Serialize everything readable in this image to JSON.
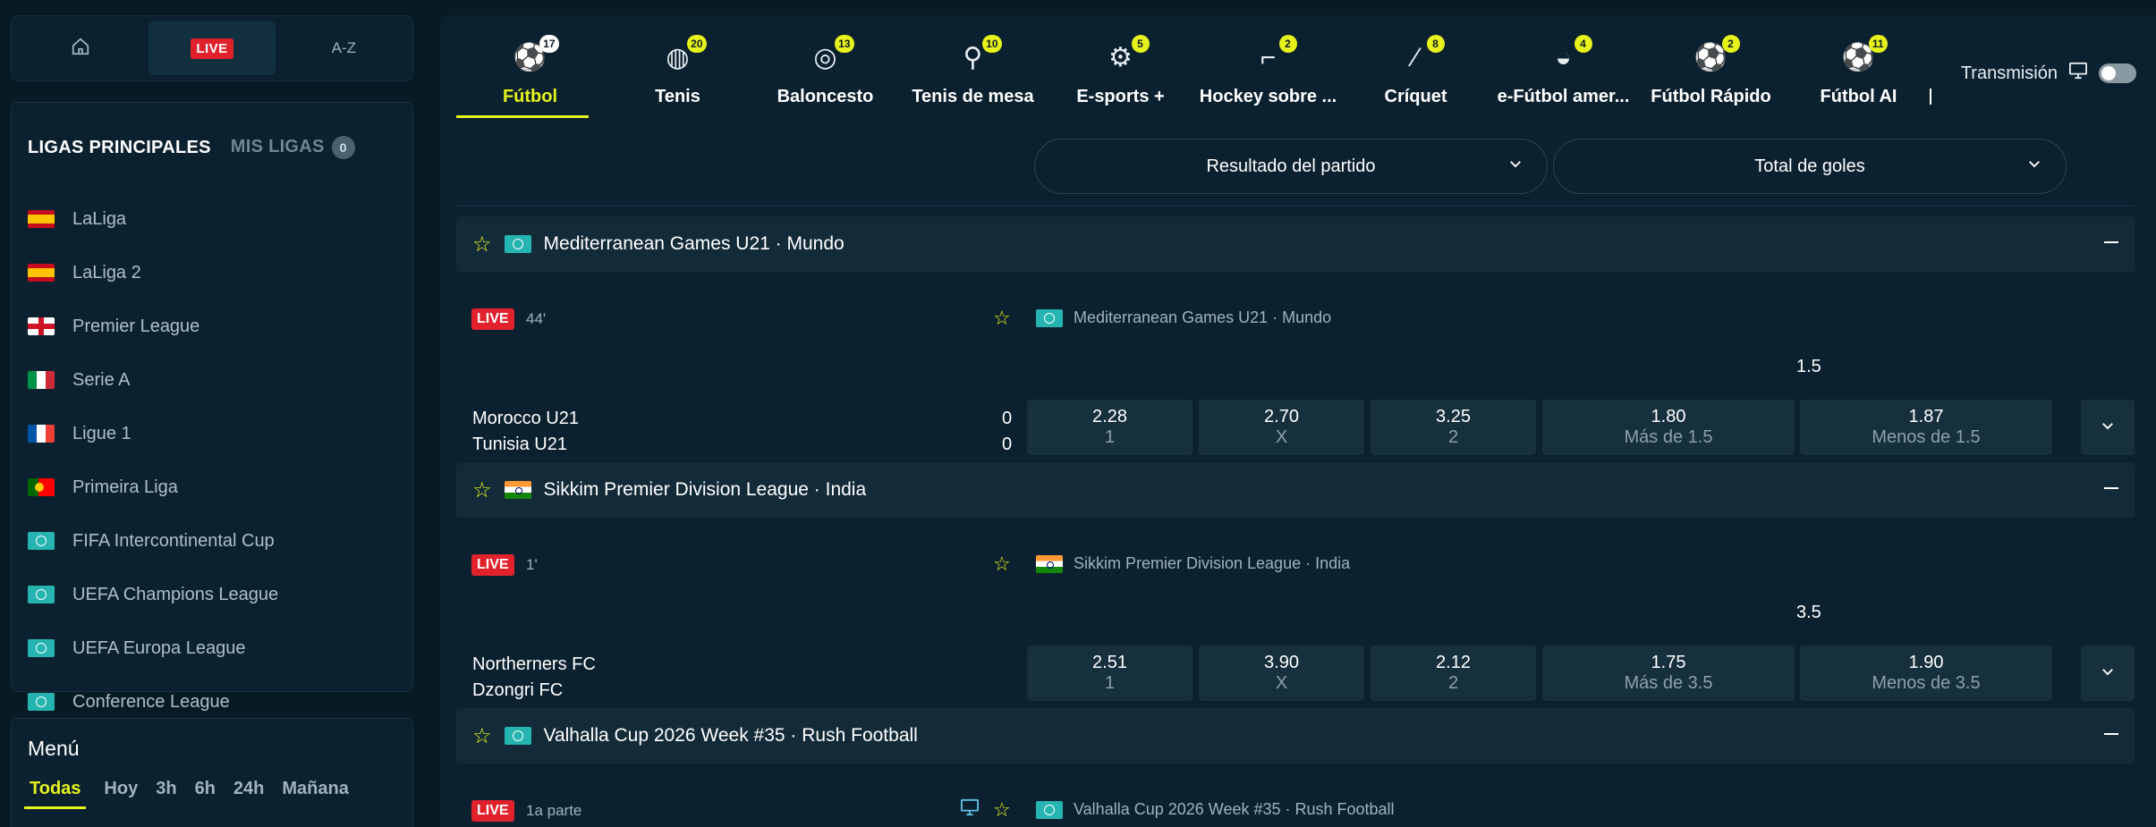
{
  "topnav": {
    "home_icon": "home-icon",
    "live": "LIVE",
    "az": "A-Z"
  },
  "leagues": {
    "tab_principal": "LIGAS PRINCIPALES",
    "tab_mine": "MIS LIGAS",
    "mine_count": "0",
    "items": [
      {
        "label": "LaLiga",
        "flag": "es"
      },
      {
        "label": "LaLiga 2",
        "flag": "es"
      },
      {
        "label": "Premier League",
        "flag": "en"
      },
      {
        "label": "Serie A",
        "flag": "it"
      },
      {
        "label": "Ligue 1",
        "flag": "fr"
      },
      {
        "label": "Primeira Liga",
        "flag": "pt"
      },
      {
        "label": "FIFA Intercontinental Cup",
        "flag": "world"
      },
      {
        "label": "UEFA Champions League",
        "flag": "world"
      },
      {
        "label": "UEFA Europa League",
        "flag": "world"
      },
      {
        "label": "Conference League",
        "flag": "world"
      }
    ]
  },
  "menu": {
    "title": "Menú",
    "tabs": [
      "Todas",
      "Hoy",
      "3h",
      "6h",
      "24h",
      "Mañana"
    ]
  },
  "sports": [
    {
      "label": "Fútbol",
      "count": "17",
      "icon": "soccer-ball-icon",
      "active": true
    },
    {
      "label": "Tenis",
      "count": "20",
      "icon": "tennis-ball-icon"
    },
    {
      "label": "Baloncesto",
      "count": "13",
      "icon": "basketball-icon"
    },
    {
      "label": "Tenis de mesa",
      "count": "10",
      "icon": "ping-pong-icon"
    },
    {
      "label": "E-sports +",
      "count": "5",
      "icon": "gamepad-icon"
    },
    {
      "label": "Hockey sobre ...",
      "count": "2",
      "icon": "hockey-icon"
    },
    {
      "label": "Críquet",
      "count": "8",
      "icon": "cricket-icon"
    },
    {
      "label": "e-Fútbol amer...",
      "count": "4",
      "icon": "e-football-icon"
    },
    {
      "label": "Fútbol Rápido",
      "count": "2",
      "icon": "fast-football-icon"
    },
    {
      "label": "Fútbol AI",
      "count": "11",
      "icon": "ai-football-icon"
    }
  ],
  "stream": {
    "label": "Transmisión"
  },
  "selectors": {
    "result": "Resultado del partido",
    "goals": "Total de goles"
  },
  "matches": [
    {
      "league": "Mediterranean Games U21 · Mundo",
      "flag": "world",
      "live": "LIVE",
      "minute": "44'",
      "line": "1.5",
      "home": "Morocco U21",
      "away": "Tunisia U21",
      "home_score": "0",
      "away_score": "0",
      "odds": [
        {
          "v": "2.28",
          "l": "1"
        },
        {
          "v": "2.70",
          "l": "X"
        },
        {
          "v": "3.25",
          "l": "2"
        },
        {
          "v": "1.80",
          "l": "Más de 1.5"
        },
        {
          "v": "1.87",
          "l": "Menos de 1.5"
        }
      ]
    },
    {
      "league": "Sikkim Premier Division League · India",
      "flag": "in",
      "live": "LIVE",
      "minute": "1'",
      "line": "3.5",
      "home": "Northerners FC",
      "away": "Dzongri FC",
      "home_score": "",
      "away_score": "",
      "odds": [
        {
          "v": "2.51",
          "l": "1"
        },
        {
          "v": "3.90",
          "l": "X"
        },
        {
          "v": "2.12",
          "l": "2"
        },
        {
          "v": "1.75",
          "l": "Más de 3.5"
        },
        {
          "v": "1.90",
          "l": "Menos de 3.5"
        }
      ]
    },
    {
      "league": "Valhalla Cup 2026 Week #35 · Rush Football",
      "flag": "world",
      "live": "LIVE",
      "minute": "1a parte"
    }
  ]
}
